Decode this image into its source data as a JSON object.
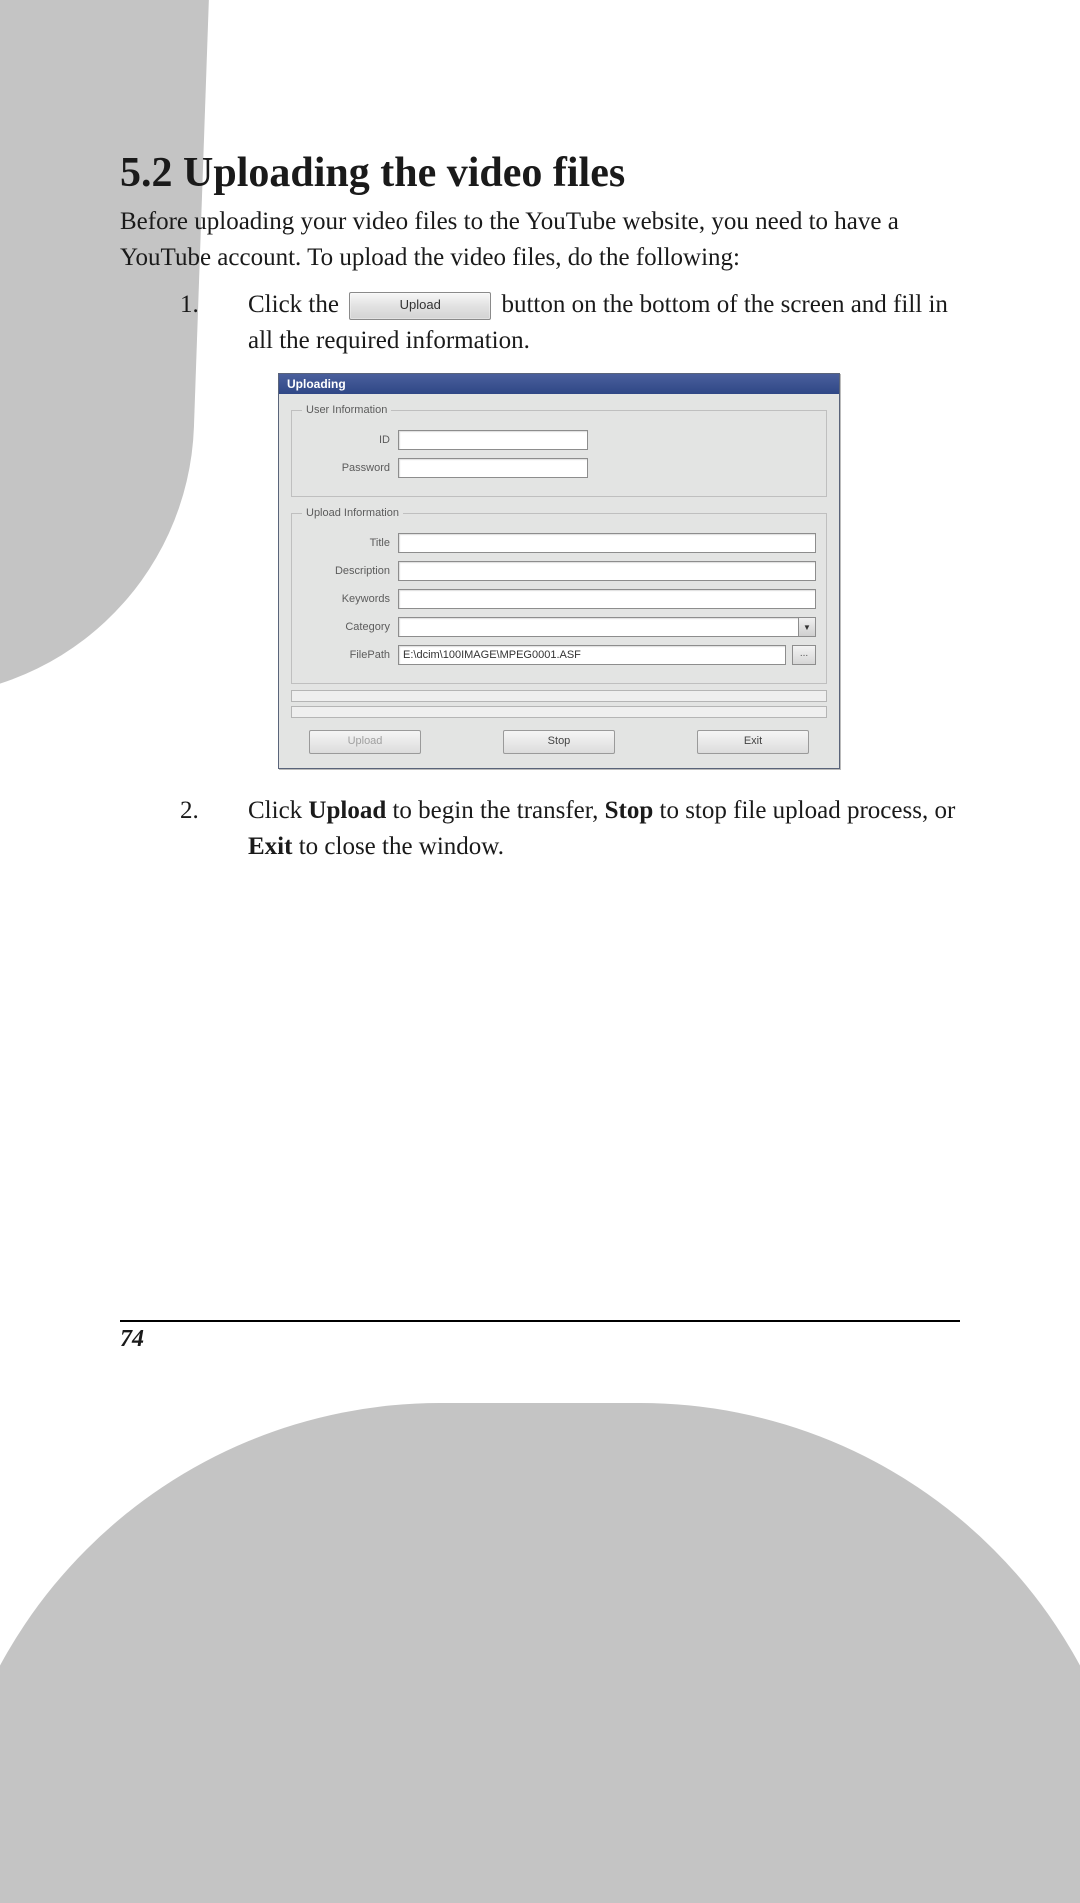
{
  "section": {
    "title": "5.2 Uploading the video files",
    "intro": "Before uploading your video files to the YouTube website, you need to have a YouTube account. To upload the video files, do the following:"
  },
  "steps": {
    "one": {
      "num": "1.",
      "before": "Click the",
      "button_label": "Upload",
      "after": "button on the bottom of the screen and fill in all the required information."
    },
    "two": {
      "num": "2.",
      "text_parts": {
        "a": "Click ",
        "b": "Upload",
        "c": " to begin the transfer, ",
        "d": "Stop",
        "e": " to stop file upload process, or ",
        "f": "Exit",
        "g": " to close the window."
      }
    }
  },
  "dialog": {
    "title": "Uploading",
    "user_info": {
      "legend": "User Information",
      "id_label": "ID",
      "id_value": "",
      "password_label": "Password",
      "password_value": ""
    },
    "upload_info": {
      "legend": "Upload Information",
      "title_label": "Title",
      "title_value": "",
      "description_label": "Description",
      "description_value": "",
      "keywords_label": "Keywords",
      "keywords_value": "",
      "category_label": "Category",
      "category_value": "",
      "filepath_label": "FilePath",
      "filepath_value": "E:\\dcim\\100IMAGE\\MPEG0001.ASF",
      "browse_label": "..."
    },
    "buttons": {
      "upload": "Upload",
      "stop": "Stop",
      "exit": "Exit"
    }
  },
  "page_number": "74"
}
